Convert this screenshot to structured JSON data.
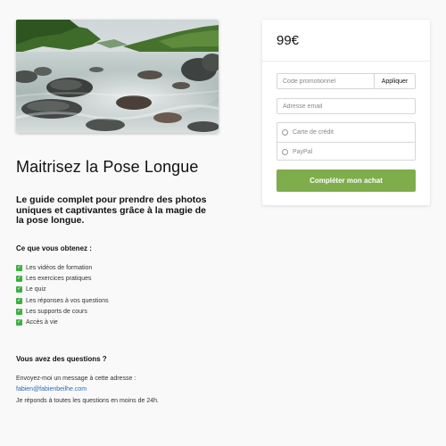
{
  "hero": {
    "image_name": "long-exposure-river-photo"
  },
  "product": {
    "title": "Maitrisez la Pose Longue",
    "subtitle": "Le guide complet pour prendre des photos uniques et captivantes grâce à la magie de la pose longue."
  },
  "benefits": {
    "heading": "Ce que vous obtenez :",
    "check_icon": "check-box-icon",
    "check_color": "#3cb043",
    "items": [
      "Les vidéos de formation",
      "Les exercices pratiques",
      "Le quiz",
      "Les réponses à vos questions",
      "Les supports de cours",
      "Accès à vie"
    ]
  },
  "contact": {
    "heading": "Vous avez des questions ?",
    "intro": "Envoyez-moi un message à cette adresse :",
    "email": "fabien@fabienbeilhe.com",
    "response": "Je réponds à toutes les questions en moins de 24h."
  },
  "checkout": {
    "price": "99€",
    "promo_placeholder": "Code promotionnel",
    "apply_label": "Appliquer",
    "email_placeholder": "Adresse email",
    "payment_options": [
      "Carte de crédit",
      "PayPal"
    ],
    "purchase_label": "Compléter mon achat",
    "accent_color": "#7fad4b"
  }
}
